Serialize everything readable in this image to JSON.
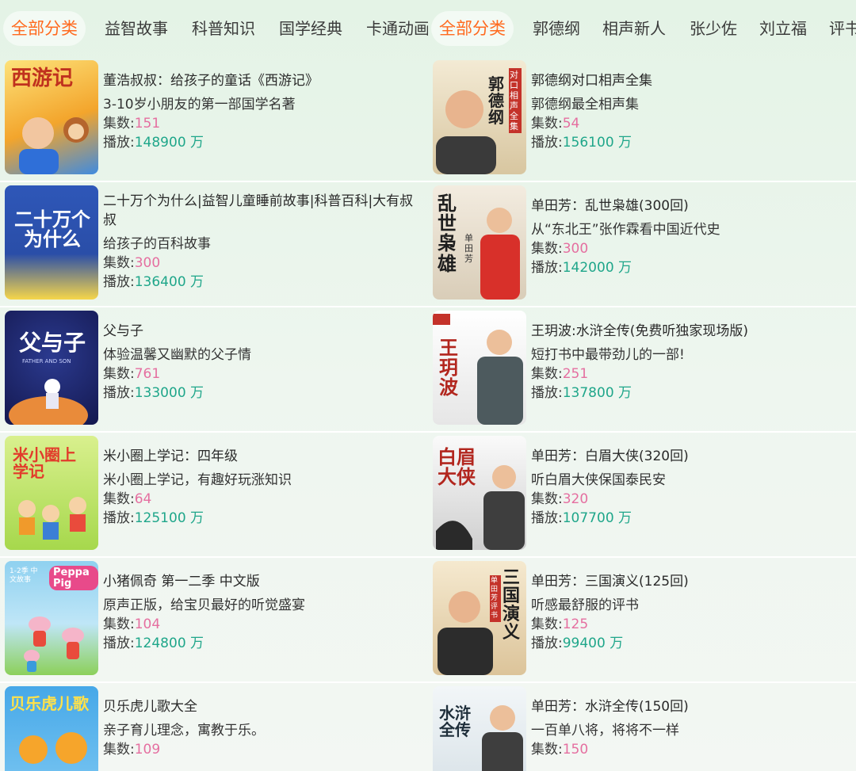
{
  "left": {
    "tabs": [
      {
        "label": "全部分类",
        "active": true
      },
      {
        "label": "益智故事"
      },
      {
        "label": "科普知识"
      },
      {
        "label": "国学经典"
      },
      {
        "label": "卡通动画"
      }
    ],
    "items": [
      {
        "title": "董浩叔叔：给孩子的童话《西游记》",
        "subtitle": "3-10岁小朋友的第一部国学名著",
        "count_label": "集数:",
        "count": "151",
        "play_label": "播放:",
        "play": "148900 万",
        "cover_text": "西游记",
        "cover_color": "#f7c23b"
      },
      {
        "title": "二十万个为什么|益智儿童睡前故事|科普百科|大有叔叔",
        "subtitle": "给孩子的百科故事",
        "count_label": "集数:",
        "count": "300",
        "play_label": "播放:",
        "play": "136400 万",
        "cover_text": "二十万个为什么",
        "cover_color": "#2e57b8"
      },
      {
        "title": "父与子",
        "subtitle": "体验温馨又幽默的父子情",
        "count_label": "集数:",
        "count": "761",
        "play_label": "播放:",
        "play": "133000 万",
        "cover_text": "父与子",
        "cover_subtext": "FATHER AND SON",
        "cover_color": "#1f2a74"
      },
      {
        "title": "米小圈上学记：四年级",
        "subtitle": "米小圈上学记，有趣好玩涨知识",
        "count_label": "集数:",
        "count": "64",
        "play_label": "播放:",
        "play": "125100 万",
        "cover_text": "米小圈上学记",
        "cover_color": "#bfe26a"
      },
      {
        "title": "小猪佩奇 第一二季 中文版",
        "subtitle": "原声正版，给宝贝最好的听觉盛宴",
        "count_label": "集数:",
        "count": "104",
        "play_label": "播放:",
        "play": "124800 万",
        "cover_text": "Peppa Pig",
        "cover_subtext": "1-2季 中文故事",
        "cover_color": "#8fd1f0"
      },
      {
        "title": "贝乐虎儿歌大全",
        "subtitle": "亲子育儿理念，寓教于乐。",
        "count_label": "集数:",
        "count": "109",
        "play_label": "播放:",
        "play": "",
        "cover_text": "贝乐虎儿歌",
        "cover_color": "#46a8e8"
      }
    ]
  },
  "right": {
    "tabs": [
      {
        "label": "全部分类",
        "active": true
      },
      {
        "label": "郭德纲"
      },
      {
        "label": "相声新人"
      },
      {
        "label": "张少佐"
      },
      {
        "label": "刘立福"
      },
      {
        "label": "评书"
      }
    ],
    "items": [
      {
        "title": "郭德纲对口相声全集",
        "subtitle": "郭德纲最全相声集",
        "count_label": "集数:",
        "count": "54",
        "play_label": "播放:",
        "play": "156100 万",
        "cover_text": "郭德纲",
        "cover_subtext": "对口相声全集",
        "cover_color": "#e9dcc2"
      },
      {
        "title": "单田芳：乱世枭雄(300回)",
        "subtitle": "从“东北王”张作霖看中国近代史",
        "count_label": "集数:",
        "count": "300",
        "play_label": "播放:",
        "play": "142000 万",
        "cover_text": "乱世枭雄",
        "cover_subtext": "单田芳",
        "cover_color": "#eee6d8"
      },
      {
        "title": "王玥波:水浒全传(免费听独家现场版)",
        "subtitle": "短打书中最带劲儿的一部!",
        "count_label": "集数:",
        "count": "251",
        "play_label": "播放:",
        "play": "137800 万",
        "cover_text": "王玥波",
        "cover_color": "#f2f2f2"
      },
      {
        "title": "单田芳：白眉大侠(320回)",
        "subtitle": "听白眉大侠保国泰民安",
        "count_label": "集数:",
        "count": "320",
        "play_label": "播放:",
        "play": "107700 万",
        "cover_text": "白眉大侠",
        "cover_color": "#e8e8e8"
      },
      {
        "title": "单田芳：三国演义(125回)",
        "subtitle": "听感最舒服的评书",
        "count_label": "集数:",
        "count": "125",
        "play_label": "播放:",
        "play": "99400 万",
        "cover_text": "三国演义",
        "cover_subtext": "单田芳评书",
        "cover_color": "#f0e2c8"
      },
      {
        "title": "单田芳：水浒全传(150回)",
        "subtitle": "一百单八将，将将不一样",
        "count_label": "集数:",
        "count": "150",
        "play_label": "播放:",
        "play": "",
        "cover_text": "水浒全传",
        "cover_color": "#eaf0f4"
      }
    ]
  }
}
